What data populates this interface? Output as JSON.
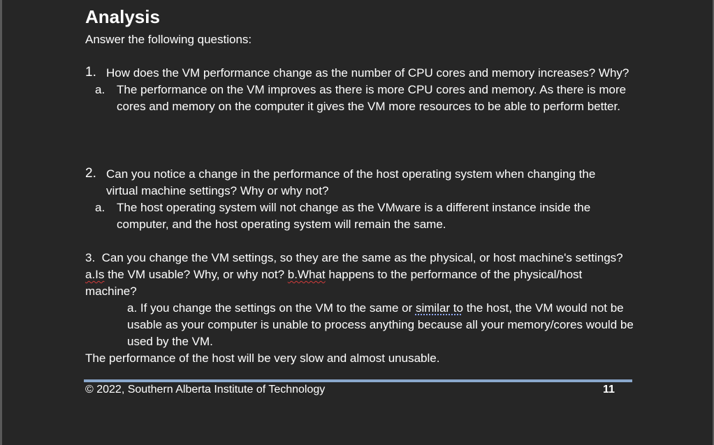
{
  "heading": "Analysis",
  "intro": "Answer the following questions:",
  "q1": {
    "number": "1.",
    "text": "How does the VM performance change as the number of CPU cores and memory increases? Why?",
    "answer_marker": "a.",
    "answer": "The performance on the VM improves as there is more CPU cores and memory. As there is more cores and memory on the computer it gives the VM more resources to be able to perform better."
  },
  "q2": {
    "number": "2.",
    "text": "Can you notice a change in the performance of the host operating system when changing the virtual machine settings? Why or why not?",
    "answer_marker": "a.",
    "answer": "The host operating system will not change as the VMware is a different instance inside the computer, and the host operating system will remain the same."
  },
  "q3": {
    "number": "3.",
    "text_1": "Can you change the VM settings, so they are the same as the physical, or host machine's settings? ",
    "part_a_label": "a.Is",
    "text_2": " the VM usable? Why, or why not? ",
    "part_b_label": "b.What",
    "text_3": " happens to the performance of the physical/host machine?",
    "answer_1": "a. If you change the settings on the VM to the same or ",
    "answer_marked": "similar to",
    "answer_2": " the host, the VM would not be usable as your computer is unable to process anything because all your memory/cores would be used by the VM.",
    "answer_3": "The performance of the host will be very slow and almost unusable."
  },
  "footer": {
    "copyright": "© 2022, Southern Alberta Institute of Technology",
    "page_number": "11"
  },
  "colors": {
    "background": "#262626",
    "text": "#ffffff",
    "rule": "#8aa8cc",
    "spellcheck": "#d23b3b",
    "grammar": "#8fa8ff"
  }
}
